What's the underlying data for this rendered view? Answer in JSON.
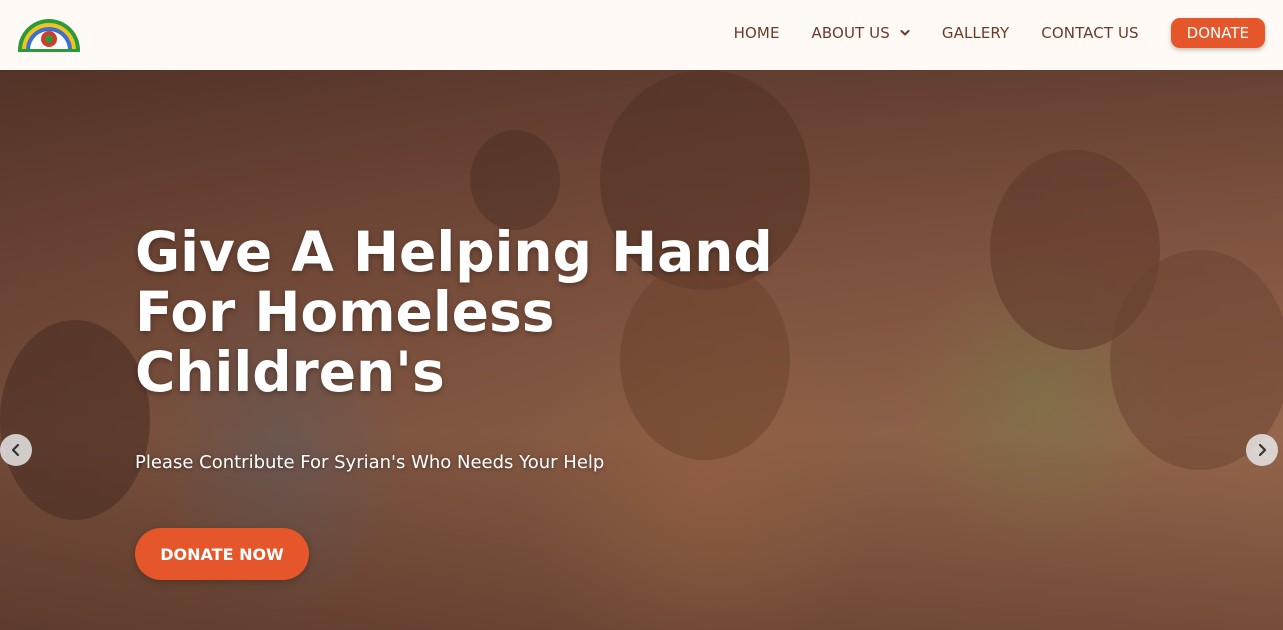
{
  "nav": {
    "items": [
      {
        "label": "HOME",
        "icon": ""
      },
      {
        "label": "ABOUT US",
        "icon": "chevron-down-icon"
      },
      {
        "label": "GALLERY",
        "icon": ""
      },
      {
        "label": "CONTACT US",
        "icon": ""
      }
    ],
    "donate_label": "DONATE"
  },
  "hero": {
    "title_line1": "Give A Helping Hand",
    "title_line2": "For Homeless",
    "title_line3": "Children's",
    "subtitle": "Please Contribute For Syrian's Who Needs Your Help",
    "cta_label": "DONATE NOW",
    "prev_icon": "chevron-left-icon",
    "next_icon": "chevron-right-icon"
  },
  "colors": {
    "accent": "#e5562a",
    "nav_text": "#6b3a2a",
    "header_bg": "#fffaf5"
  }
}
